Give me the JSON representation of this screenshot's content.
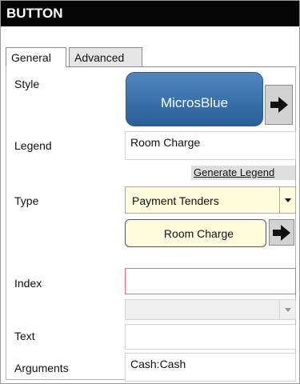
{
  "window": {
    "title": "BUTTON"
  },
  "tabs": [
    {
      "label": "General",
      "active": true
    },
    {
      "label": "Advanced",
      "active": false
    }
  ],
  "style": {
    "label": "Style",
    "button_text": "MicrosBlue",
    "color": "#3d74ae"
  },
  "legend": {
    "label": "Legend",
    "value": "Room Charge",
    "generate_link": "Generate Legend"
  },
  "type": {
    "label": "Type",
    "selected": "Payment Tenders",
    "tender_button_text": "Room Charge"
  },
  "index": {
    "label": "Index",
    "value": ""
  },
  "text": {
    "label": "Text",
    "value": ""
  },
  "arguments": {
    "label": "Arguments",
    "value": "Cash:Cash"
  },
  "icons": {
    "arrow": "arrow-right-icon",
    "caret": "chevron-down-icon"
  }
}
